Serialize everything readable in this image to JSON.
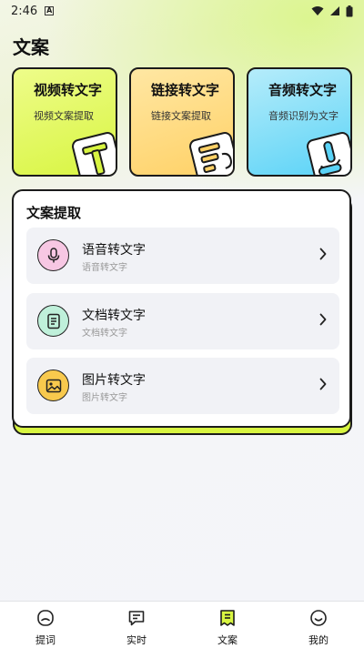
{
  "status_bar": {
    "time": "2:46",
    "notification_glyph": "A"
  },
  "page": {
    "title": "文案"
  },
  "cards": [
    {
      "title": "视频转文字",
      "subtitle": "视频文案提取",
      "icon": "text-t-icon",
      "color": "#d8f541"
    },
    {
      "title": "链接转文字",
      "subtitle": "链接文案提取",
      "icon": "link-doc-icon",
      "color": "#ffd166"
    },
    {
      "title": "音频转文字",
      "subtitle": "音频识别为文字",
      "icon": "audio-link-icon",
      "color": "#5ad3f7"
    }
  ],
  "extraction": {
    "title": "文案提取",
    "items": [
      {
        "title": "语音转文字",
        "subtitle": "语音转文字",
        "icon": "microphone-icon",
        "color": "#f7c7e3"
      },
      {
        "title": "文档转文字",
        "subtitle": "文档转文字",
        "icon": "document-icon",
        "color": "#bff0da"
      },
      {
        "title": "图片转文字",
        "subtitle": "图片转文字",
        "icon": "image-icon",
        "color": "#f8c94d"
      }
    ]
  },
  "bottom_nav": [
    {
      "label": "提词",
      "icon": "teleprompter-icon"
    },
    {
      "label": "实时",
      "icon": "chat-icon"
    },
    {
      "label": "文案",
      "icon": "copywriting-icon",
      "active": true
    },
    {
      "label": "我的",
      "icon": "profile-icon"
    }
  ]
}
